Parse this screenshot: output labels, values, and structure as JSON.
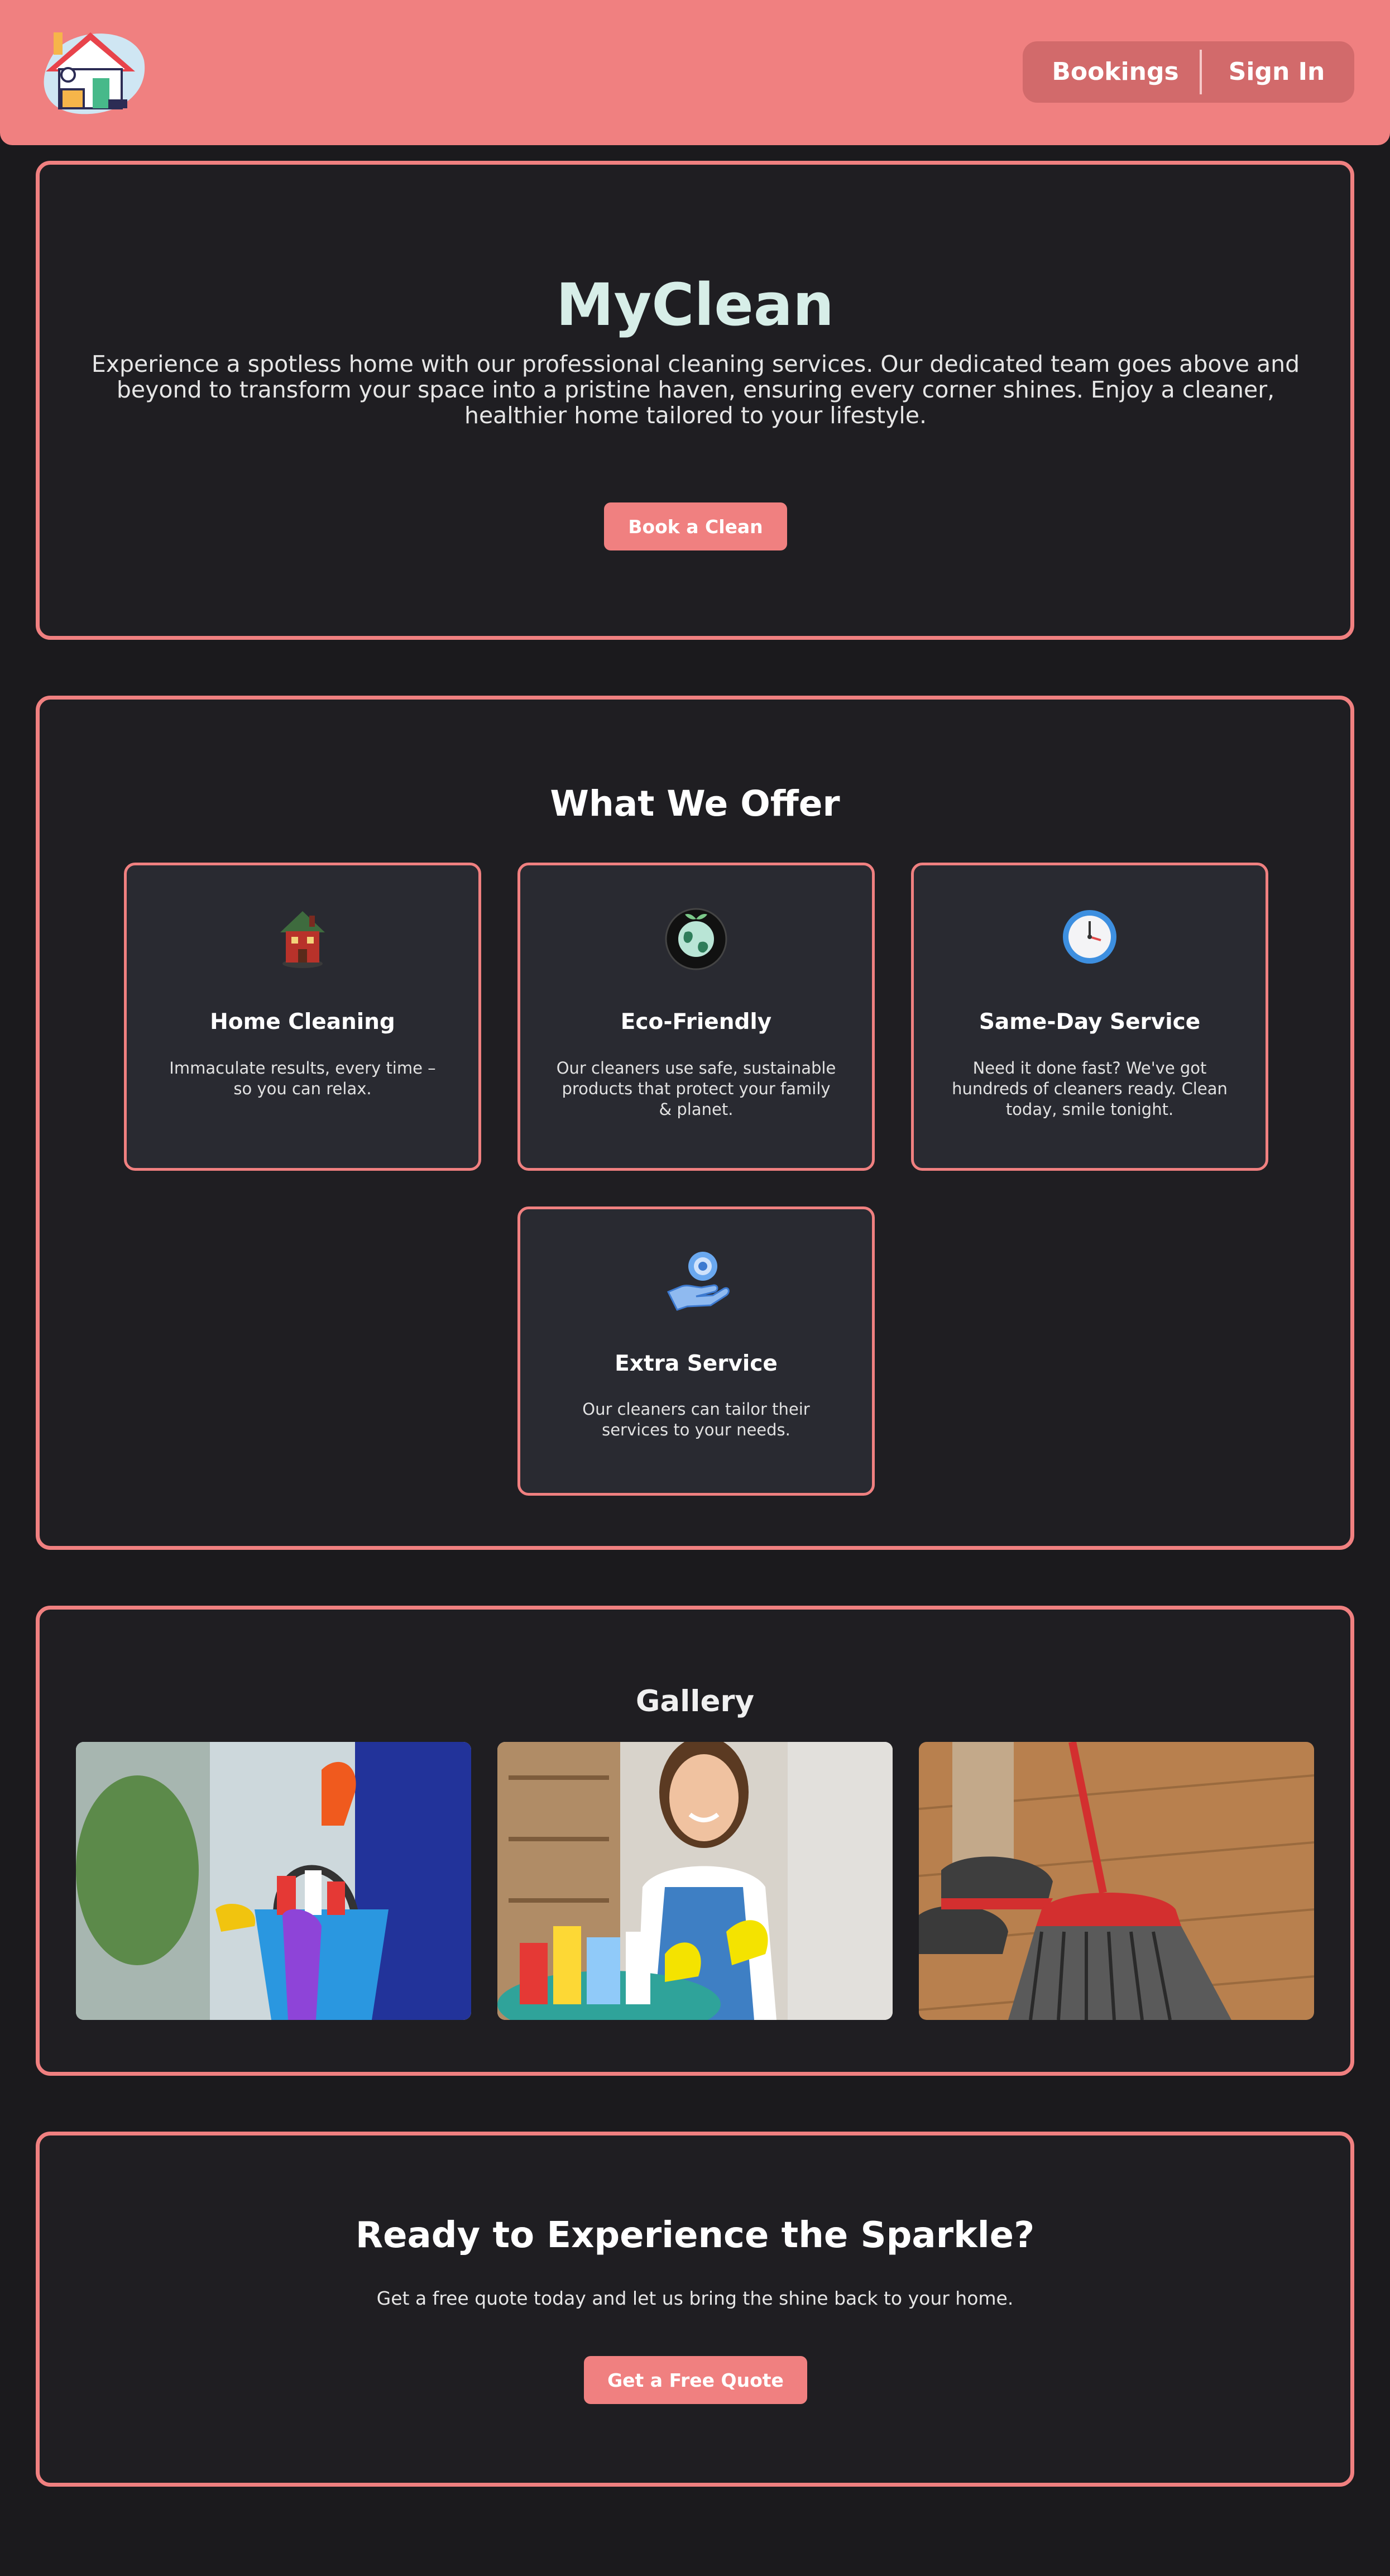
{
  "header": {
    "logo_icon": "house-cleaning-logo-icon",
    "nav": {
      "bookings": "Bookings",
      "sign_in": "Sign In"
    }
  },
  "hero": {
    "title": "MyClean",
    "description": "Experience a spotless home with our professional cleaning services. Our dedicated team goes above and beyond to transform your space into a pristine haven, ensuring every corner shines. Enjoy a cleaner, healthier home tailored to your lifestyle.",
    "cta": "Book a Clean"
  },
  "offer": {
    "title": "What We Offer",
    "cards": [
      {
        "icon": "red-house-icon",
        "title": "Home Cleaning",
        "text": "Immaculate results, every time – so you can relax."
      },
      {
        "icon": "eco-globe-icon",
        "title": "Eco-Friendly",
        "text": "Our cleaners use safe, sustainable products that protect your family & planet."
      },
      {
        "icon": "clock-icon",
        "title": "Same-Day Service",
        "text": "Need it done fast? We've got hundreds of cleaners ready. Clean today, smile tonight."
      },
      {
        "icon": "hand-gear-icon",
        "title": "Extra Service",
        "text": "Our cleaners can tailor their services to your needs."
      }
    ]
  },
  "gallery": {
    "title": "Gallery",
    "images": [
      "cleaning-bucket-photo",
      "smiling-cleaner-photo",
      "broom-sweeping-photo"
    ]
  },
  "cta_section": {
    "title": "Ready to Experience the Sparkle?",
    "subtitle": "Get a free quote today and let us bring the shine back to your home.",
    "button": "Get a Free Quote"
  },
  "colors": {
    "accent": "#f08080",
    "background": "#1b1a1d",
    "card": "#292a31",
    "hero_title": "#d7eee8"
  }
}
